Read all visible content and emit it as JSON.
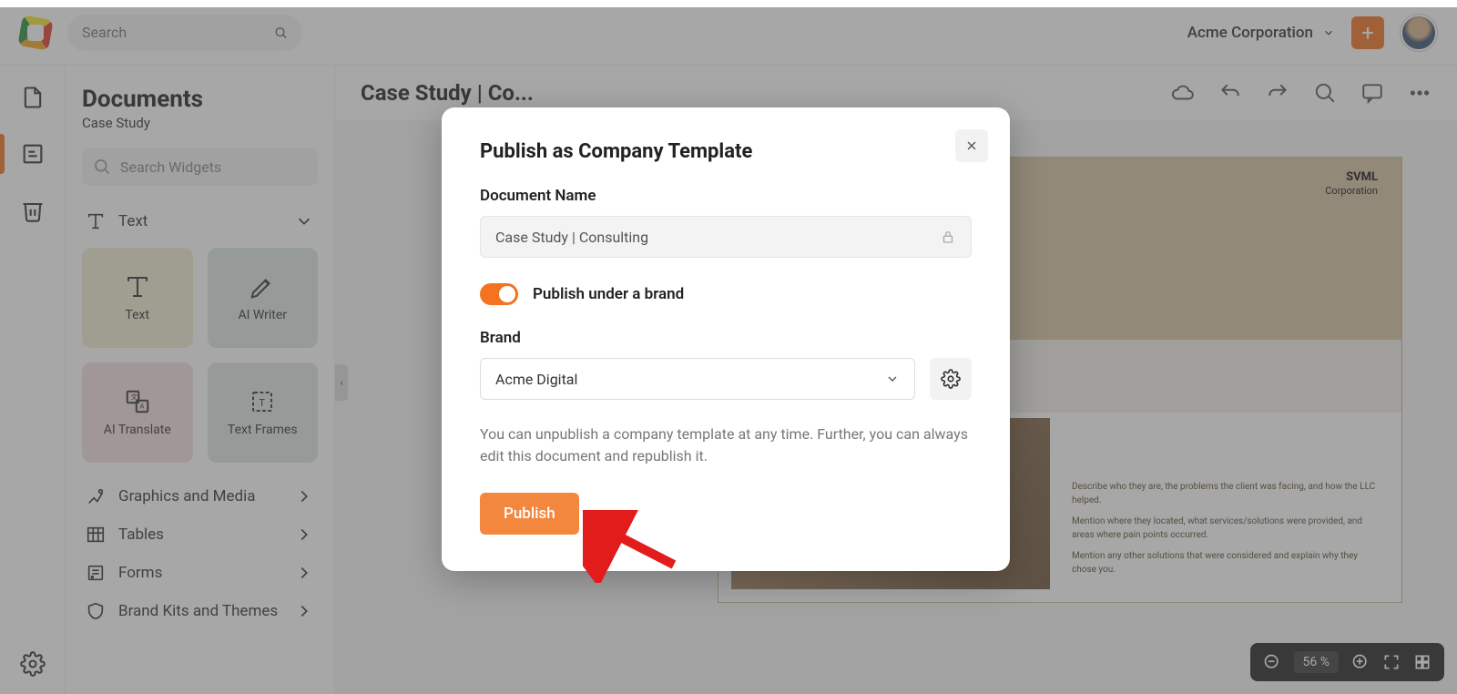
{
  "top": {
    "search_placeholder": "Search",
    "workspace": "Acme Corporation"
  },
  "panel": {
    "title": "Documents",
    "subtitle": "Case Study",
    "widget_search_placeholder": "Search Widgets",
    "section_text": "Text",
    "tiles": {
      "text": "Text",
      "ai_writer": "AI Writer",
      "ai_translate": "AI Translate",
      "text_frames": "Text Frames"
    },
    "menu": {
      "graphics": "Graphics and Media",
      "tables": "Tables",
      "forms": "Forms",
      "brand": "Brand Kits and Themes"
    }
  },
  "canvas": {
    "title": "Case Study | Co...",
    "preview": {
      "brand_line1": "SVML",
      "brand_line2": "Corporation",
      "p1": "Describe who they are, the problems the client was facing, and how the LLC helped.",
      "p2": "Mention where they located, what services/solutions were provided, and areas where pain points occurred.",
      "p3": "Mention any other solutions that were considered and explain why they chose you."
    },
    "zoom": "56 %"
  },
  "modal": {
    "title": "Publish as Company Template",
    "doc_name_label": "Document Name",
    "doc_name_value": "Case Study | Consulting",
    "toggle_label": "Publish under a brand",
    "brand_label": "Brand",
    "brand_value": "Acme Digital",
    "hint": "You can unpublish a company template at any time. Further, you can always edit this document and republish it.",
    "publish": "Publish"
  }
}
